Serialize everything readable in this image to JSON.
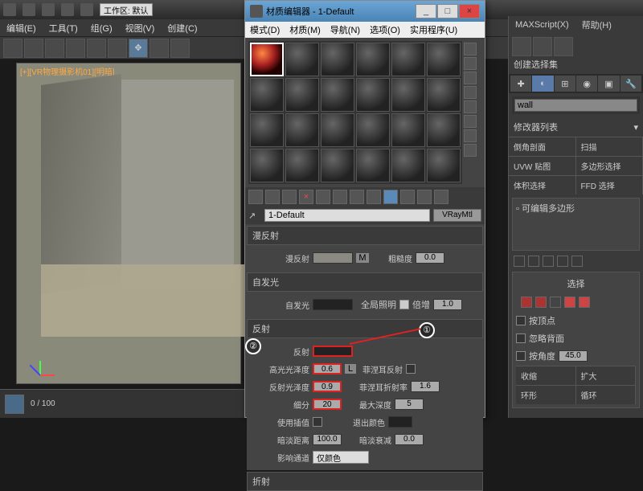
{
  "app": {
    "workspace_label": "工作区: 默认",
    "menus": [
      "编辑(E)",
      "工具(T)",
      "组(G)",
      "视图(V)",
      "创建(C)",
      "",
      "MAXScript(X)",
      "帮助(H)"
    ]
  },
  "viewport": {
    "label": "[+][VR物理摄影机01][明暗]"
  },
  "material_editor": {
    "title": "材质编辑器 - 1-Default",
    "menus": [
      "模式(D)",
      "材质(M)",
      "导航(N)",
      "选项(O)",
      "实用程序(U)"
    ],
    "name": "1-Default",
    "type": "VRayMtl",
    "window_buttons": {
      "min": "_",
      "max": "□",
      "close": "×"
    },
    "rollouts": {
      "diffuse": {
        "title": "漫反射",
        "label": "漫反射",
        "m_label": "M",
        "rough_label": "粗糙度",
        "rough": "0.0"
      },
      "self_illum": {
        "title": "自发光",
        "label": "自发光",
        "gi_label": "全局照明",
        "mult_label": "倍增",
        "mult": "1.0"
      },
      "reflection": {
        "title": "反射",
        "label": "反射",
        "hilight_label": "高光光泽度",
        "hilight": "0.6",
        "refl_gloss_label": "反射光泽度",
        "refl_gloss": "0.9",
        "subdiv_label": "细分",
        "subdiv": "20",
        "use_interp_label": "使用插值",
        "dim_dist_label": "暗淡距离",
        "dim_dist": "100.0",
        "affect_label": "影响通道",
        "affect_val": "仅颜色",
        "fresnel_label": "菲涅耳反射",
        "fresnel_ior_label": "菲涅耳折射率",
        "fresnel_ior": "1.6",
        "max_depth_label": "最大深度",
        "max_depth": "5",
        "exit_label": "退出颜色",
        "dim_falloff_label": "暗淡衰减",
        "dim_falloff": "0.0",
        "l_label": "L"
      },
      "refraction": {
        "title": "折射"
      }
    },
    "callouts": {
      "c1": "①",
      "c2": "②"
    }
  },
  "right_panel": {
    "menus": [
      "MAXScript(X)",
      "帮助(H)"
    ],
    "create_header": "创建选择集",
    "object_name": "wall",
    "modifier_list": "修改器列表",
    "pairs": [
      [
        "倒角剖面",
        "扫描"
      ],
      [
        "UVW 贴图",
        "多边形选择"
      ],
      [
        "体积选择",
        "FFD 选择"
      ]
    ],
    "editable": "可编辑多边形",
    "select_title": "选择",
    "by_vertex": "按顶点",
    "ignore_back": "忽略背面",
    "by_angle": "按角度",
    "angle_val": "45.0",
    "shrink": "收缩",
    "grow": "扩大",
    "ring": "环形",
    "loop": "循环"
  },
  "timeline": {
    "range": "0 / 100"
  }
}
